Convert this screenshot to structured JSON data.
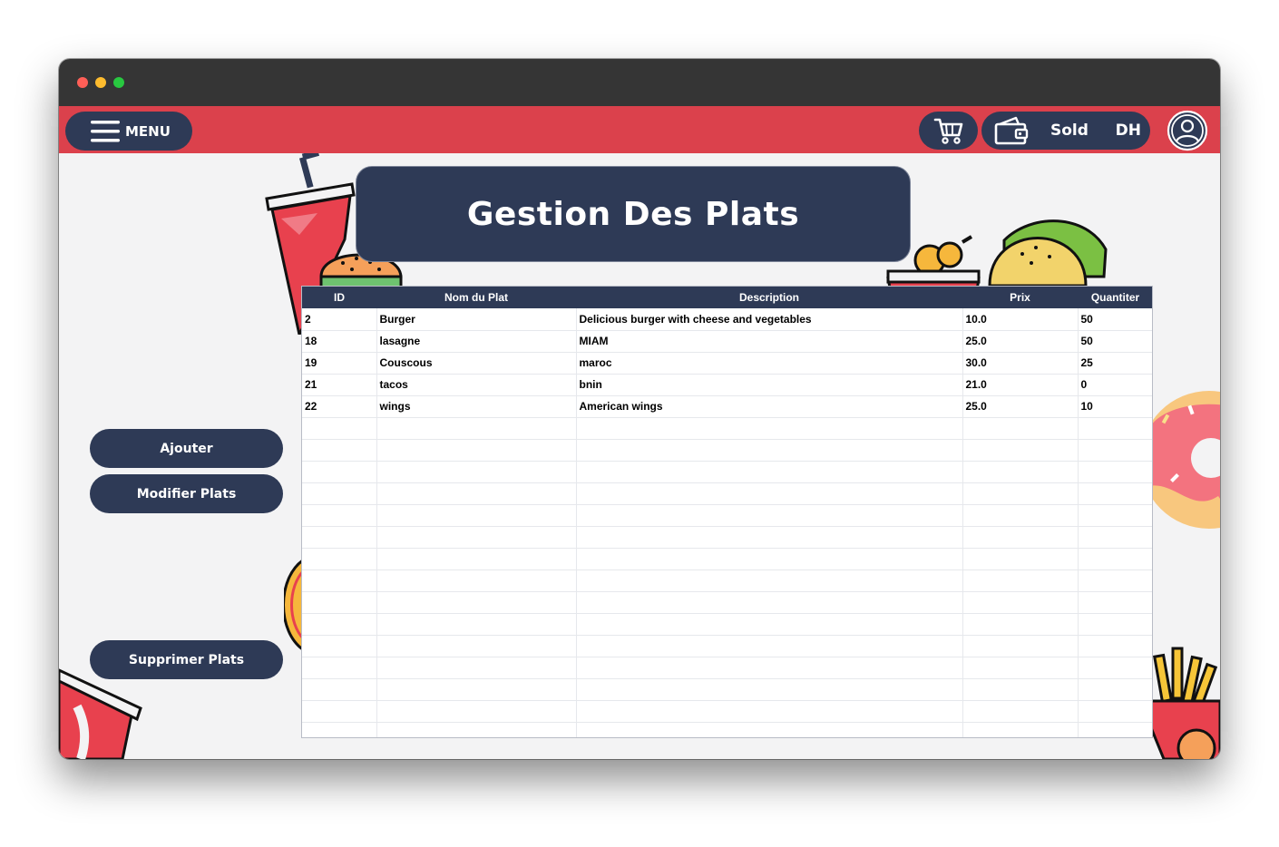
{
  "menu": {
    "label": "MENU"
  },
  "wallet": {
    "sold_label": "Sold",
    "currency": "DH"
  },
  "page_title": "Gestion Des Plats",
  "actions": {
    "add": "Ajouter",
    "edit": "Modifier Plats",
    "delete": "Supprimer Plats"
  },
  "table": {
    "columns": [
      "ID",
      "Nom du Plat",
      "Description",
      "Prix",
      "Quantiter"
    ],
    "rows": [
      [
        "2",
        "Burger",
        "Delicious burger with cheese and vegetables",
        "10.0",
        "50"
      ],
      [
        "18",
        "lasagne",
        "MIAM",
        "25.0",
        "50"
      ],
      [
        "19",
        "Couscous",
        "maroc",
        "30.0",
        "25"
      ],
      [
        "21",
        "tacos",
        "bnin",
        "21.0",
        "0"
      ],
      [
        "22",
        "wings",
        "American wings",
        "25.0",
        "10"
      ]
    ]
  },
  "colors": {
    "topbar": "#db414c",
    "navy": "#2e3a56",
    "background": "#f3f3f4"
  },
  "icons": [
    "hamburger-menu-icon",
    "shopping-cart-icon",
    "wallet-icon",
    "user-avatar-icon"
  ]
}
